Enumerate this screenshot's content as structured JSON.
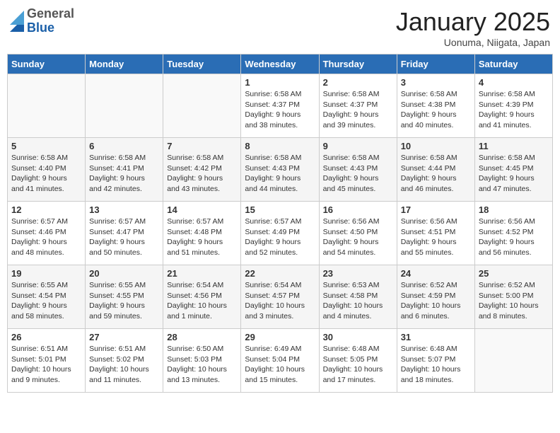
{
  "header": {
    "logo_general": "General",
    "logo_blue": "Blue",
    "title": "January 2025",
    "subtitle": "Uonuma, Niigata, Japan"
  },
  "weekdays": [
    "Sunday",
    "Monday",
    "Tuesday",
    "Wednesday",
    "Thursday",
    "Friday",
    "Saturday"
  ],
  "weeks": [
    [
      {
        "day": "",
        "info": ""
      },
      {
        "day": "",
        "info": ""
      },
      {
        "day": "",
        "info": ""
      },
      {
        "day": "1",
        "info": "Sunrise: 6:58 AM\nSunset: 4:37 PM\nDaylight: 9 hours\nand 38 minutes."
      },
      {
        "day": "2",
        "info": "Sunrise: 6:58 AM\nSunset: 4:37 PM\nDaylight: 9 hours\nand 39 minutes."
      },
      {
        "day": "3",
        "info": "Sunrise: 6:58 AM\nSunset: 4:38 PM\nDaylight: 9 hours\nand 40 minutes."
      },
      {
        "day": "4",
        "info": "Sunrise: 6:58 AM\nSunset: 4:39 PM\nDaylight: 9 hours\nand 41 minutes."
      }
    ],
    [
      {
        "day": "5",
        "info": "Sunrise: 6:58 AM\nSunset: 4:40 PM\nDaylight: 9 hours\nand 41 minutes."
      },
      {
        "day": "6",
        "info": "Sunrise: 6:58 AM\nSunset: 4:41 PM\nDaylight: 9 hours\nand 42 minutes."
      },
      {
        "day": "7",
        "info": "Sunrise: 6:58 AM\nSunset: 4:42 PM\nDaylight: 9 hours\nand 43 minutes."
      },
      {
        "day": "8",
        "info": "Sunrise: 6:58 AM\nSunset: 4:43 PM\nDaylight: 9 hours\nand 44 minutes."
      },
      {
        "day": "9",
        "info": "Sunrise: 6:58 AM\nSunset: 4:43 PM\nDaylight: 9 hours\nand 45 minutes."
      },
      {
        "day": "10",
        "info": "Sunrise: 6:58 AM\nSunset: 4:44 PM\nDaylight: 9 hours\nand 46 minutes."
      },
      {
        "day": "11",
        "info": "Sunrise: 6:58 AM\nSunset: 4:45 PM\nDaylight: 9 hours\nand 47 minutes."
      }
    ],
    [
      {
        "day": "12",
        "info": "Sunrise: 6:57 AM\nSunset: 4:46 PM\nDaylight: 9 hours\nand 48 minutes."
      },
      {
        "day": "13",
        "info": "Sunrise: 6:57 AM\nSunset: 4:47 PM\nDaylight: 9 hours\nand 50 minutes."
      },
      {
        "day": "14",
        "info": "Sunrise: 6:57 AM\nSunset: 4:48 PM\nDaylight: 9 hours\nand 51 minutes."
      },
      {
        "day": "15",
        "info": "Sunrise: 6:57 AM\nSunset: 4:49 PM\nDaylight: 9 hours\nand 52 minutes."
      },
      {
        "day": "16",
        "info": "Sunrise: 6:56 AM\nSunset: 4:50 PM\nDaylight: 9 hours\nand 54 minutes."
      },
      {
        "day": "17",
        "info": "Sunrise: 6:56 AM\nSunset: 4:51 PM\nDaylight: 9 hours\nand 55 minutes."
      },
      {
        "day": "18",
        "info": "Sunrise: 6:56 AM\nSunset: 4:52 PM\nDaylight: 9 hours\nand 56 minutes."
      }
    ],
    [
      {
        "day": "19",
        "info": "Sunrise: 6:55 AM\nSunset: 4:54 PM\nDaylight: 9 hours\nand 58 minutes."
      },
      {
        "day": "20",
        "info": "Sunrise: 6:55 AM\nSunset: 4:55 PM\nDaylight: 9 hours\nand 59 minutes."
      },
      {
        "day": "21",
        "info": "Sunrise: 6:54 AM\nSunset: 4:56 PM\nDaylight: 10 hours\nand 1 minute."
      },
      {
        "day": "22",
        "info": "Sunrise: 6:54 AM\nSunset: 4:57 PM\nDaylight: 10 hours\nand 3 minutes."
      },
      {
        "day": "23",
        "info": "Sunrise: 6:53 AM\nSunset: 4:58 PM\nDaylight: 10 hours\nand 4 minutes."
      },
      {
        "day": "24",
        "info": "Sunrise: 6:52 AM\nSunset: 4:59 PM\nDaylight: 10 hours\nand 6 minutes."
      },
      {
        "day": "25",
        "info": "Sunrise: 6:52 AM\nSunset: 5:00 PM\nDaylight: 10 hours\nand 8 minutes."
      }
    ],
    [
      {
        "day": "26",
        "info": "Sunrise: 6:51 AM\nSunset: 5:01 PM\nDaylight: 10 hours\nand 9 minutes."
      },
      {
        "day": "27",
        "info": "Sunrise: 6:51 AM\nSunset: 5:02 PM\nDaylight: 10 hours\nand 11 minutes."
      },
      {
        "day": "28",
        "info": "Sunrise: 6:50 AM\nSunset: 5:03 PM\nDaylight: 10 hours\nand 13 minutes."
      },
      {
        "day": "29",
        "info": "Sunrise: 6:49 AM\nSunset: 5:04 PM\nDaylight: 10 hours\nand 15 minutes."
      },
      {
        "day": "30",
        "info": "Sunrise: 6:48 AM\nSunset: 5:05 PM\nDaylight: 10 hours\nand 17 minutes."
      },
      {
        "day": "31",
        "info": "Sunrise: 6:48 AM\nSunset: 5:07 PM\nDaylight: 10 hours\nand 18 minutes."
      },
      {
        "day": "",
        "info": ""
      }
    ]
  ]
}
